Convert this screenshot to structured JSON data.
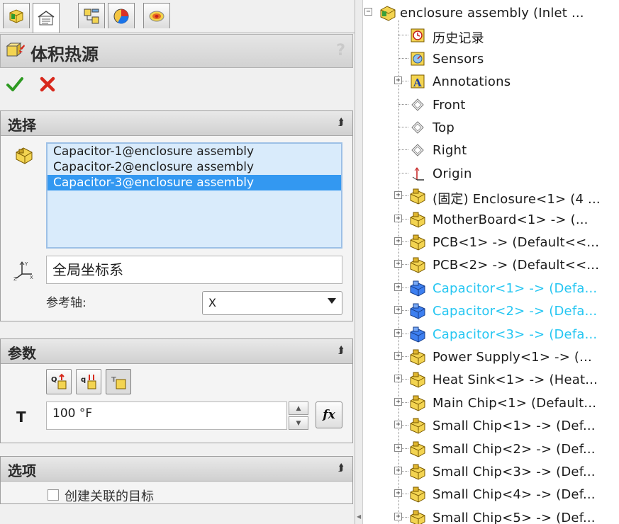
{
  "tabs": [
    {
      "name": "feature-manager-tab-icon"
    },
    {
      "name": "property-manager-tab-icon"
    },
    {
      "name": "configuration-manager-tab-icon"
    },
    {
      "name": "display-manager-tab-icon"
    },
    {
      "name": "simulation-study-tab-icon"
    }
  ],
  "feature": {
    "title": "体积热源",
    "help": "?"
  },
  "selection": {
    "title": "选择",
    "items": [
      "Capacitor-1@enclosure assembly",
      "Capacitor-2@enclosure assembly",
      "Capacitor-3@enclosure assembly"
    ],
    "selected_index": 2,
    "coordinate_system": "全局坐标系",
    "axis_label": "参考轴:",
    "axis_value": "X"
  },
  "parameters": {
    "title": "参数",
    "t_label": "T",
    "t_value": "100 °F",
    "fx_label": "fx"
  },
  "options": {
    "title": "选项",
    "checkbox_label": "创建关联的目标",
    "checked": false
  },
  "colors": {
    "selection_bg": "#d9ebfb",
    "selected_row": "#3398f1",
    "highlight_text": "#25c6f2"
  },
  "tree": [
    {
      "text": "enclosure assembly  (Inlet ...",
      "icon": "assembly-icon",
      "expander": "minus",
      "level": 0
    },
    {
      "text": "历史记录",
      "icon": "history-icon",
      "expander": "",
      "level": 1
    },
    {
      "text": "Sensors",
      "icon": "sensor-icon",
      "expander": "",
      "level": 1
    },
    {
      "text": "Annotations",
      "icon": "annotation-icon",
      "expander": "plus",
      "level": 1
    },
    {
      "text": "Front",
      "icon": "plane-icon",
      "expander": "",
      "level": 1
    },
    {
      "text": "Top",
      "icon": "plane-icon",
      "expander": "",
      "level": 1
    },
    {
      "text": "Right",
      "icon": "plane-icon",
      "expander": "",
      "level": 1
    },
    {
      "text": "Origin",
      "icon": "origin-icon",
      "expander": "",
      "level": 1
    },
    {
      "text": "(固定) Enclosure<1> (4 ...",
      "icon": "part-icon",
      "expander": "plus",
      "level": 1
    },
    {
      "text": "MotherBoard<1> -> (...",
      "icon": "part-icon",
      "expander": "plus",
      "level": 1
    },
    {
      "text": "PCB<1> -> (Default<<...",
      "icon": "part-icon",
      "expander": "plus",
      "level": 1
    },
    {
      "text": "PCB<2> -> (Default<<...",
      "icon": "part-icon",
      "expander": "plus",
      "level": 1
    },
    {
      "text": "Capacitor<1> -> (Defa...",
      "icon": "part-selected-icon",
      "expander": "plus",
      "level": 1,
      "highlight": true
    },
    {
      "text": "Capacitor<2> -> (Defa...",
      "icon": "part-selected-icon",
      "expander": "plus",
      "level": 1,
      "highlight": true
    },
    {
      "text": "Capacitor<3> -> (Defa...",
      "icon": "part-selected-icon",
      "expander": "plus",
      "level": 1,
      "highlight": true
    },
    {
      "text": "Power Supply<1> -> (...",
      "icon": "part-icon",
      "expander": "plus",
      "level": 1
    },
    {
      "text": "Heat Sink<1> -> (Heat...",
      "icon": "part-icon",
      "expander": "plus",
      "level": 1
    },
    {
      "text": "Main Chip<1> (Default...",
      "icon": "part-icon",
      "expander": "plus",
      "level": 1
    },
    {
      "text": "Small Chip<1> -> (Def...",
      "icon": "part-icon",
      "expander": "plus",
      "level": 1
    },
    {
      "text": "Small Chip<2> -> (Def...",
      "icon": "part-icon",
      "expander": "plus",
      "level": 1
    },
    {
      "text": "Small Chip<3> -> (Def...",
      "icon": "part-icon",
      "expander": "plus",
      "level": 1
    },
    {
      "text": "Small Chip<4> -> (Def...",
      "icon": "part-icon",
      "expander": "plus",
      "level": 1
    },
    {
      "text": "Small Chip<5> -> (Def...",
      "icon": "part-icon",
      "expander": "plus",
      "level": 1
    }
  ]
}
